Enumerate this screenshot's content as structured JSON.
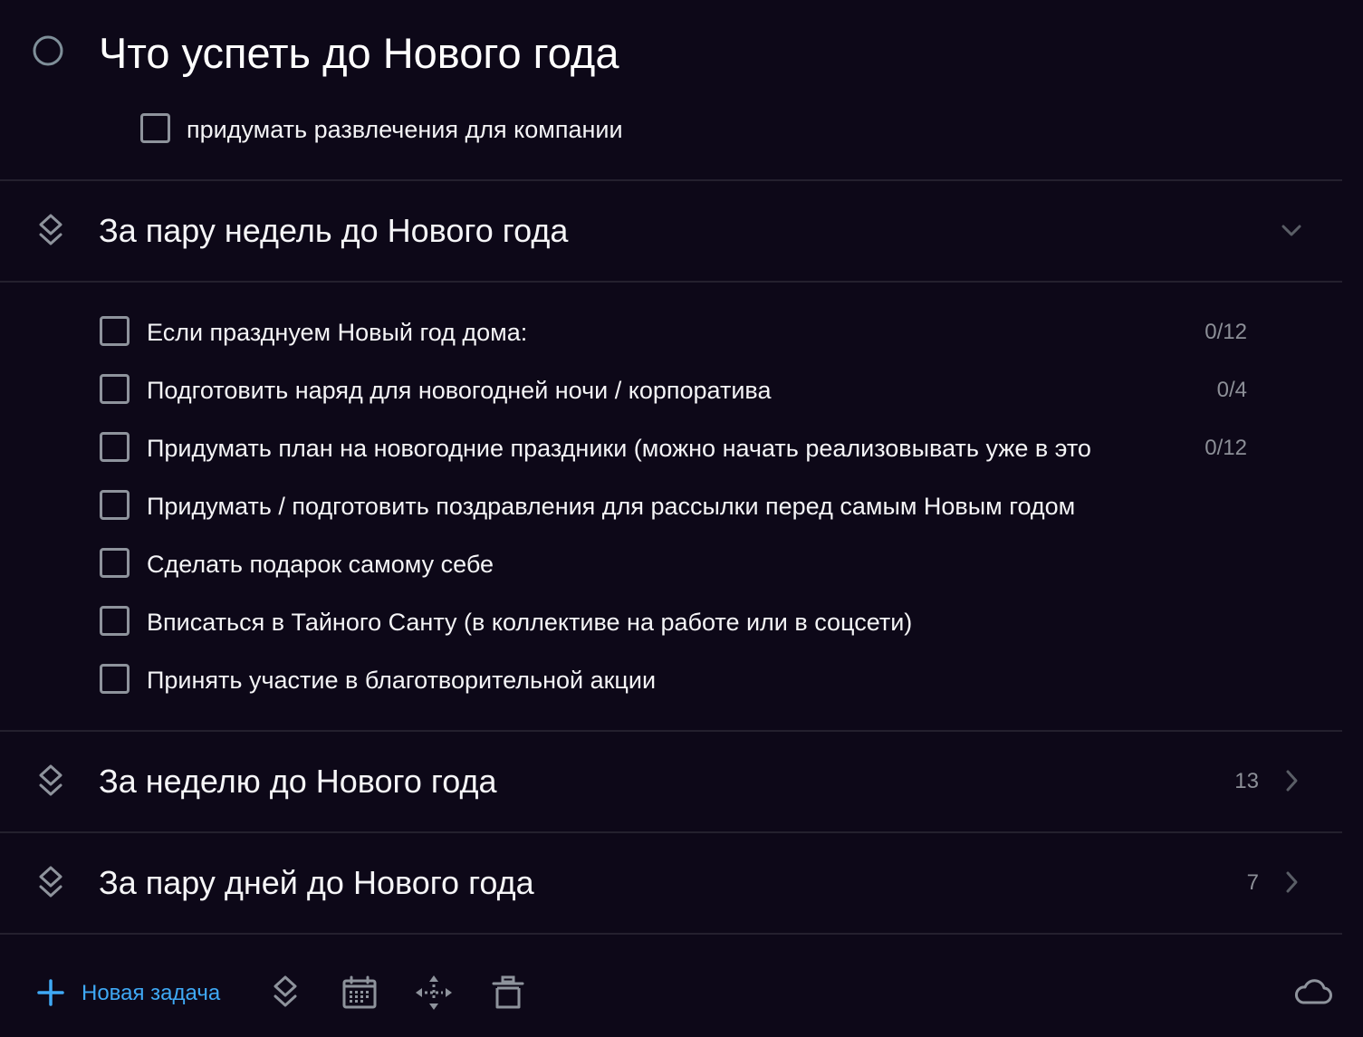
{
  "project": {
    "title": "Что успеть до Нового года",
    "tasks": [
      {
        "label": "придумать развлечения для компании"
      }
    ]
  },
  "headings": [
    {
      "title": "За пару недель до Нового года",
      "expanded": true,
      "tasks": [
        {
          "label": "Если празднуем Новый год дома:",
          "progress": "0/12"
        },
        {
          "label": "Подготовить наряд для новогодней ночи / корпоратива",
          "progress": "0/4"
        },
        {
          "label": "Придумать план на новогодние праздники (можно начать реализовывать уже в это",
          "progress": "0/12"
        },
        {
          "label": "Придумать / подготовить поздравления для рассылки перед самым Новым годом"
        },
        {
          "label": "Сделать подарок самому себе"
        },
        {
          "label": "Вписаться в Тайного Санту (в коллективе на работе или в соцсети)"
        },
        {
          "label": "Принять участие в благотворительной акции"
        }
      ]
    },
    {
      "title": "За неделю до Нового года",
      "count": "13",
      "expanded": false
    },
    {
      "title": "За пару дней до Нового года",
      "count": "7",
      "expanded": false
    }
  ],
  "toolbar": {
    "new_task_label": "Новая задача",
    "icons": [
      "plus-icon",
      "heading-icon",
      "calendar-icon",
      "move-icon",
      "trash-icon",
      "cloud-icon"
    ]
  },
  "colors": {
    "background": "#0d0818",
    "accent": "#3fa9f5",
    "checkbox": "#8e939c",
    "muted_text": "#8c8f97",
    "divider": "#24202e"
  }
}
